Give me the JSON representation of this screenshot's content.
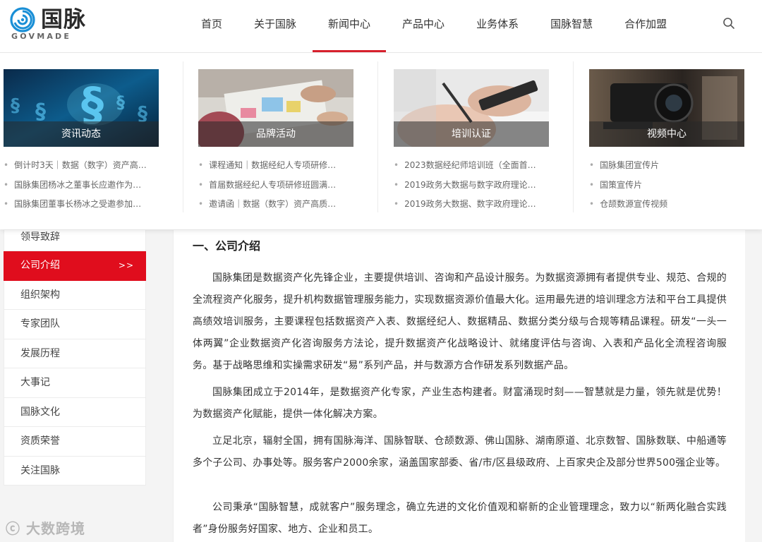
{
  "brand": {
    "name_cn": "国脉",
    "name_en": "GOVMADE",
    "color": "#1a8fd6"
  },
  "accent_color": "#e00d1d",
  "nav": {
    "items": [
      "首页",
      "关于国脉",
      "新闻中心",
      "产品中心",
      "业务体系",
      "国脉智慧",
      "合作加盟"
    ],
    "active_index": 2,
    "search_icon": "search-icon"
  },
  "dropdown": {
    "columns": [
      {
        "caption": "资讯动态",
        "links": [
          "倒计时3天｜数据（数字）资产高…",
          "国脉集团杨冰之董事长应邀作为…",
          "国脉集团董事长杨冰之受邀参加…"
        ]
      },
      {
        "caption": "品牌活动",
        "links": [
          "课程通知｜数据经纪人专项研修…",
          "首届数据经纪人专项研修班圆满…",
          "邀请函｜数据（数字）资产高质…"
        ]
      },
      {
        "caption": "培训认证",
        "links": [
          "2023数据经纪师培训班（全面首…",
          "2019政务大数据与数字政府理论…",
          "2019政务大数据、数字政府理论…"
        ]
      },
      {
        "caption": "视频中心",
        "links": [
          "国脉集团宣传片",
          "国策宣传片",
          "仓颉数源宣传视频"
        ]
      }
    ]
  },
  "sidebar": {
    "items": [
      "领导致辞",
      "公司介绍",
      "组织架构",
      "专家团队",
      "发展历程",
      "大事记",
      "国脉文化",
      "资质荣誉",
      "关注国脉"
    ],
    "active_index": 1,
    "active_arrow": ">>"
  },
  "main": {
    "heading": "一、公司介绍",
    "paragraphs": [
      "国脉集团是数据资产化先锋企业，主要提供培训、咨询和产品设计服务。为数据资源拥有者提供专业、规范、合规的全流程资产化服务，提升机构数据管理服务能力，实现数据资源价值最大化。运用最先进的培训理念方法和平台工具提供高绩效培训服务，主要课程包括数据资产入表、数据经纪人、数据精品、数据分类分级与合规等精品课程。研发“一头一体两翼”企业数据资产化咨询服务方法论，提升数据资产化战略设计、就绪度评估与咨询、入表和产品化全流程咨询服务。基于战略思维和实操需求研发“易”系列产品，并与数源方合作研发系列数据产品。",
      "国脉集团成立于2014年，是数据资产化专家，产业生态构建者。财富涌现时刻——智慧就是力量，领先就是优势！为数据资产化赋能，提供一体化解决方案。",
      "立足北京，辐射全国，拥有国脉海洋、国脉智联、仓颉数源、佛山国脉、湖南原道、北京数智、国脉数联、中船通等多个子公司、办事处等。服务客户2000余家，涵盖国家部委、省/市/区县级政府、上百家央企及部分世界500强企业等。",
      "公司秉承“国脉智慧，成就客户”服务理念，确立先进的文化价值观和崭新的企业管理理念，致力以“新两化融合实践者”身份服务好国家、地方、企业和员工。"
    ]
  },
  "watermark": "大数跨境"
}
